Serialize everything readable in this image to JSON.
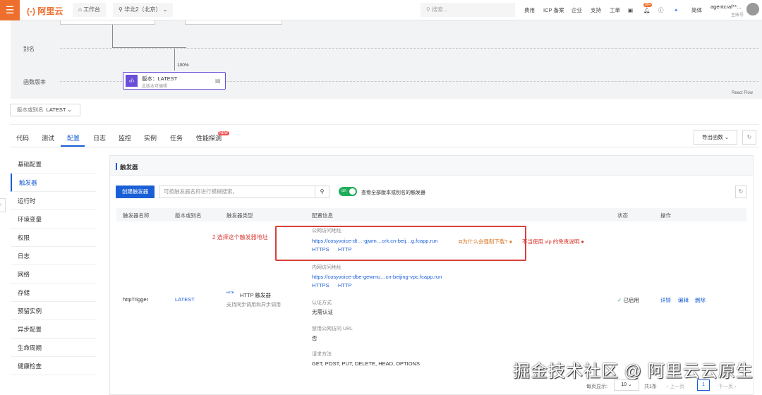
{
  "topbar": {
    "logo": "阿里云",
    "workbench": "工作台",
    "region": "华北2（北京）",
    "search_placeholder": "搜索...",
    "nav": [
      "费用",
      "ICP 备案",
      "企业",
      "支持",
      "工单"
    ],
    "badge": "99+",
    "lang": "简体",
    "user": "agentcraf**...",
    "account_type": "主账号"
  },
  "flow": {
    "alias_label": "别名",
    "version_label": "函数版本",
    "percent": "100%",
    "node_title": "版本：LATEST",
    "node_sub": "此版本可编辑",
    "footer": "React Flow"
  },
  "version_select": {
    "label": "版本或别名",
    "value": "LATEST"
  },
  "tabs": [
    "代码",
    "测试",
    "配置",
    "日志",
    "监控",
    "实例",
    "任务",
    "性能探测"
  ],
  "tab_badge": "NEW",
  "export_label": "导出函数",
  "sidebar": [
    "基础配置",
    "触发器",
    "运行时",
    "环境变量",
    "权限",
    "日志",
    "网络",
    "存储",
    "预留实例",
    "异步配置",
    "生命周期",
    "健康检查"
  ],
  "panel": {
    "title": "触发器",
    "create": "创建触发器",
    "search_placeholder": "可按触发器名称进行模糊搜索。",
    "toggle": "on",
    "toggle_text": "查看全部版本或别名的触发器"
  },
  "table": {
    "headers": [
      "触发器名称",
      "版本或别名",
      "触发器类型",
      "配置信息",
      "状态",
      "操作"
    ],
    "row": {
      "name": "httpTrigger",
      "version": "LATEST",
      "type_tag": "HTTP",
      "type": "HTTP 触发器",
      "type_sub": "支持同步调用和异步调用",
      "status": "已启用",
      "actions": [
        "详情",
        "编辑",
        "删除"
      ],
      "public_label": "公网访问地址",
      "public_url": "https://cosyvoice-dt…-gjwm…crk.cn-beij…g.fcapp.run",
      "why": "为什么会强制下载?",
      "vip": "不当使用 vip 的免责说明",
      "proto": [
        "HTTPS",
        "HTTP"
      ],
      "internal_label": "内网访问地址",
      "internal_url": "https://cosyvoice-dbe-gewmu…cn-beijing-vpc.fcapp.run",
      "auth_label": "认证方式",
      "auth": "无需认证",
      "disable_label": "禁用公网访问 URL",
      "disable": "否",
      "methods_label": "请求方法",
      "methods": "GET, POST, PUT, DELETE, HEAD, OPTIONS"
    }
  },
  "annotation": "2 选择这个触发器地址",
  "pagination": {
    "per_page_label": "每页显示:",
    "per_page": "10",
    "total": "共1条",
    "prev": "上一页",
    "page": "1",
    "next": "下一页"
  },
  "watermark": "掘金技术社区 @ 阿里云云原生"
}
